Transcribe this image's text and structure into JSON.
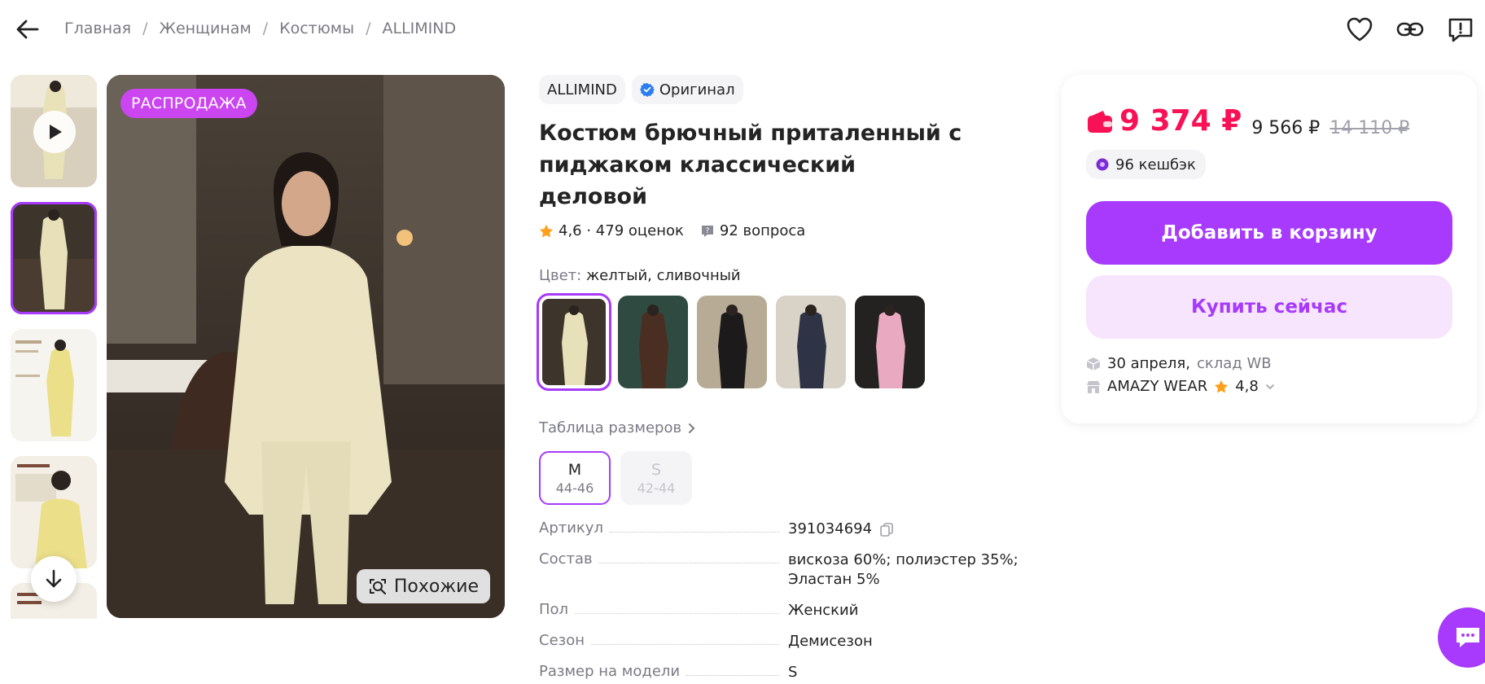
{
  "breadcrumbs": [
    "Главная",
    "Женщинам",
    "Костюмы",
    "ALLIMIND"
  ],
  "icons": {
    "back": "arrow-left-icon",
    "favorite": "heart-icon",
    "share": "link-icon",
    "report": "chat-alert-icon"
  },
  "gallery": {
    "sale_badge": "РАСПРОДАЖА",
    "similar_label": "Похожие",
    "thumbnail_count": 5,
    "active_thumbnail": 2
  },
  "product": {
    "brand": "ALLIMIND",
    "original_label": "Оригинал",
    "title": "Костюм брючный приталенный с пиджаком классический деловой",
    "rating": "4,6",
    "reviews": "479 оценок",
    "rating_line": "4,6 · 479 оценок",
    "questions": "92 вопроса",
    "color_label": "Цвет:",
    "color_value": "желтый, сливочный",
    "size_table_label": "Таблица размеров",
    "sizes": [
      {
        "name": "M",
        "range": "44-46",
        "available": true,
        "selected": true
      },
      {
        "name": "S",
        "range": "42-44",
        "available": false,
        "selected": false
      }
    ],
    "specs": [
      {
        "key": "Артикул",
        "value": "391034694"
      },
      {
        "key": "Состав",
        "value": "вискоза 60%; полиэстер 35%; Эластан 5%"
      },
      {
        "key": "Пол",
        "value": "Женский"
      },
      {
        "key": "Сезон",
        "value": "Демисезон"
      },
      {
        "key": "Размер на модели",
        "value": "S"
      }
    ]
  },
  "buy_panel": {
    "price": "9 374 ₽",
    "price_wallet": "9 566 ₽",
    "price_old": "14 110 ₽",
    "cashback": "96 кешбэк",
    "add_to_cart": "Добавить в корзину",
    "buy_now": "Купить сейчас",
    "delivery_date": "30 апреля,",
    "delivery_warehouse": "склад WB",
    "seller_name": "AMAZY WEAR",
    "seller_rating": "4,8"
  },
  "colors": {
    "accent": "#a73afd",
    "price": "#f91155",
    "sale_badge": "#cb45f0"
  }
}
